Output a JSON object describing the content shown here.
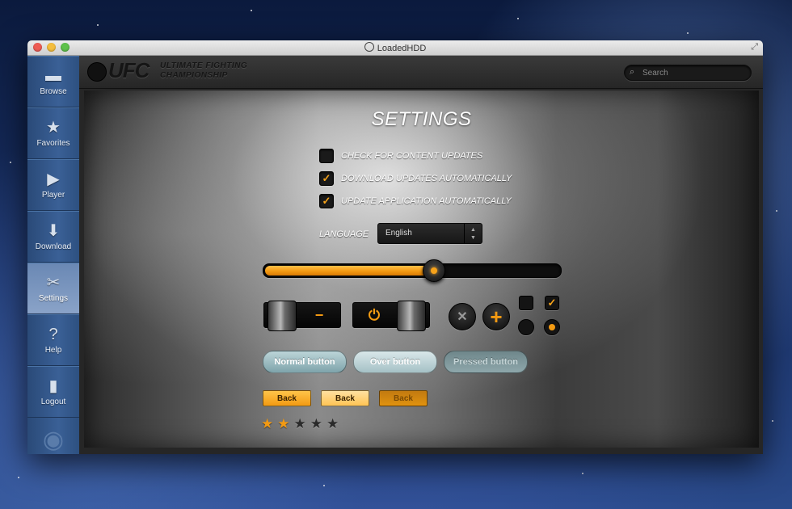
{
  "window": {
    "title": "LoadedHDD"
  },
  "sidebar": {
    "items": [
      {
        "label": "Browse",
        "icon": "folder-icon"
      },
      {
        "label": "Favorites",
        "icon": "star-icon"
      },
      {
        "label": "Player",
        "icon": "play-icon"
      },
      {
        "label": "Download",
        "icon": "download-tray-icon"
      },
      {
        "label": "Settings",
        "icon": "tools-icon",
        "active": true
      },
      {
        "label": "Help",
        "icon": "help-icon"
      },
      {
        "label": "Logout",
        "icon": "door-icon"
      }
    ]
  },
  "header": {
    "logo": "UFC",
    "logo_line1": "ULTIMATE FIGHTING",
    "logo_line2": "CHAMPIONSHIP",
    "search_placeholder": "Search"
  },
  "settings": {
    "title": "SETTINGS",
    "options": [
      {
        "label": "CHECK FOR CONTENT UPDATES",
        "checked": false
      },
      {
        "label": "DOWNLOAD UPDATES AUTOMATICALLY",
        "checked": true
      },
      {
        "label": "UPDATE APPLICATION AUTOMATICALLY",
        "checked": true
      }
    ],
    "language_label": "LANGUAGE",
    "language_value": "English",
    "slider_value": 0.57
  },
  "controls": {
    "minus_glyph": "−",
    "power_glyph": "⏻",
    "close_glyph": "✕",
    "plus_glyph": "+",
    "check_glyph": "✓"
  },
  "buttons": {
    "normal": "Normal button",
    "over": "Over button",
    "pressed": "Pressed button",
    "back": "Back"
  },
  "rating": {
    "value": 2,
    "max": 5
  },
  "colors": {
    "accent": "#f39a12",
    "sidebar": "#3a6096"
  }
}
